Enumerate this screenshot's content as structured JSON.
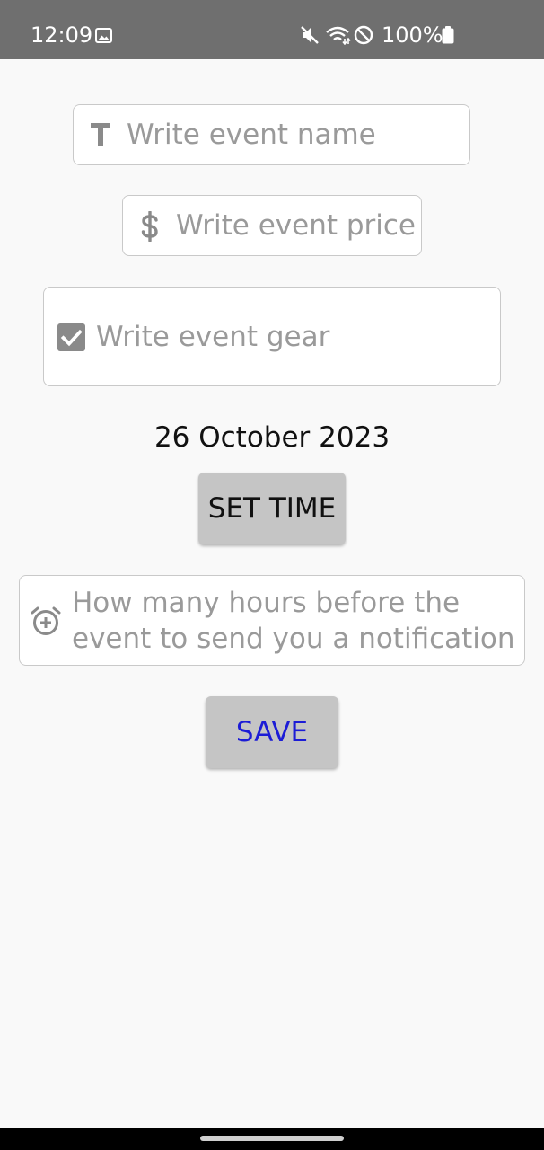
{
  "status_bar": {
    "time": "12:09",
    "battery": "100%",
    "icons": [
      "gallery-icon",
      "mute-icon",
      "wifi-icon",
      "do-not-disturb-icon",
      "battery-icon"
    ]
  },
  "form": {
    "name_placeholder": "Write event name",
    "price_placeholder": "Write event price",
    "gear_placeholder": "Write event gear",
    "date": "26 October 2023",
    "set_time_label": "SET TIME",
    "notification_placeholder": "How many hours before the event to send you a notification",
    "save_label": "SAVE"
  },
  "colors": {
    "status_bar": "#6f6f6f",
    "background": "#f9f9f9",
    "button": "#c5c5c5",
    "save_text": "#1c1cd6",
    "placeholder": "#9a9a9a"
  }
}
